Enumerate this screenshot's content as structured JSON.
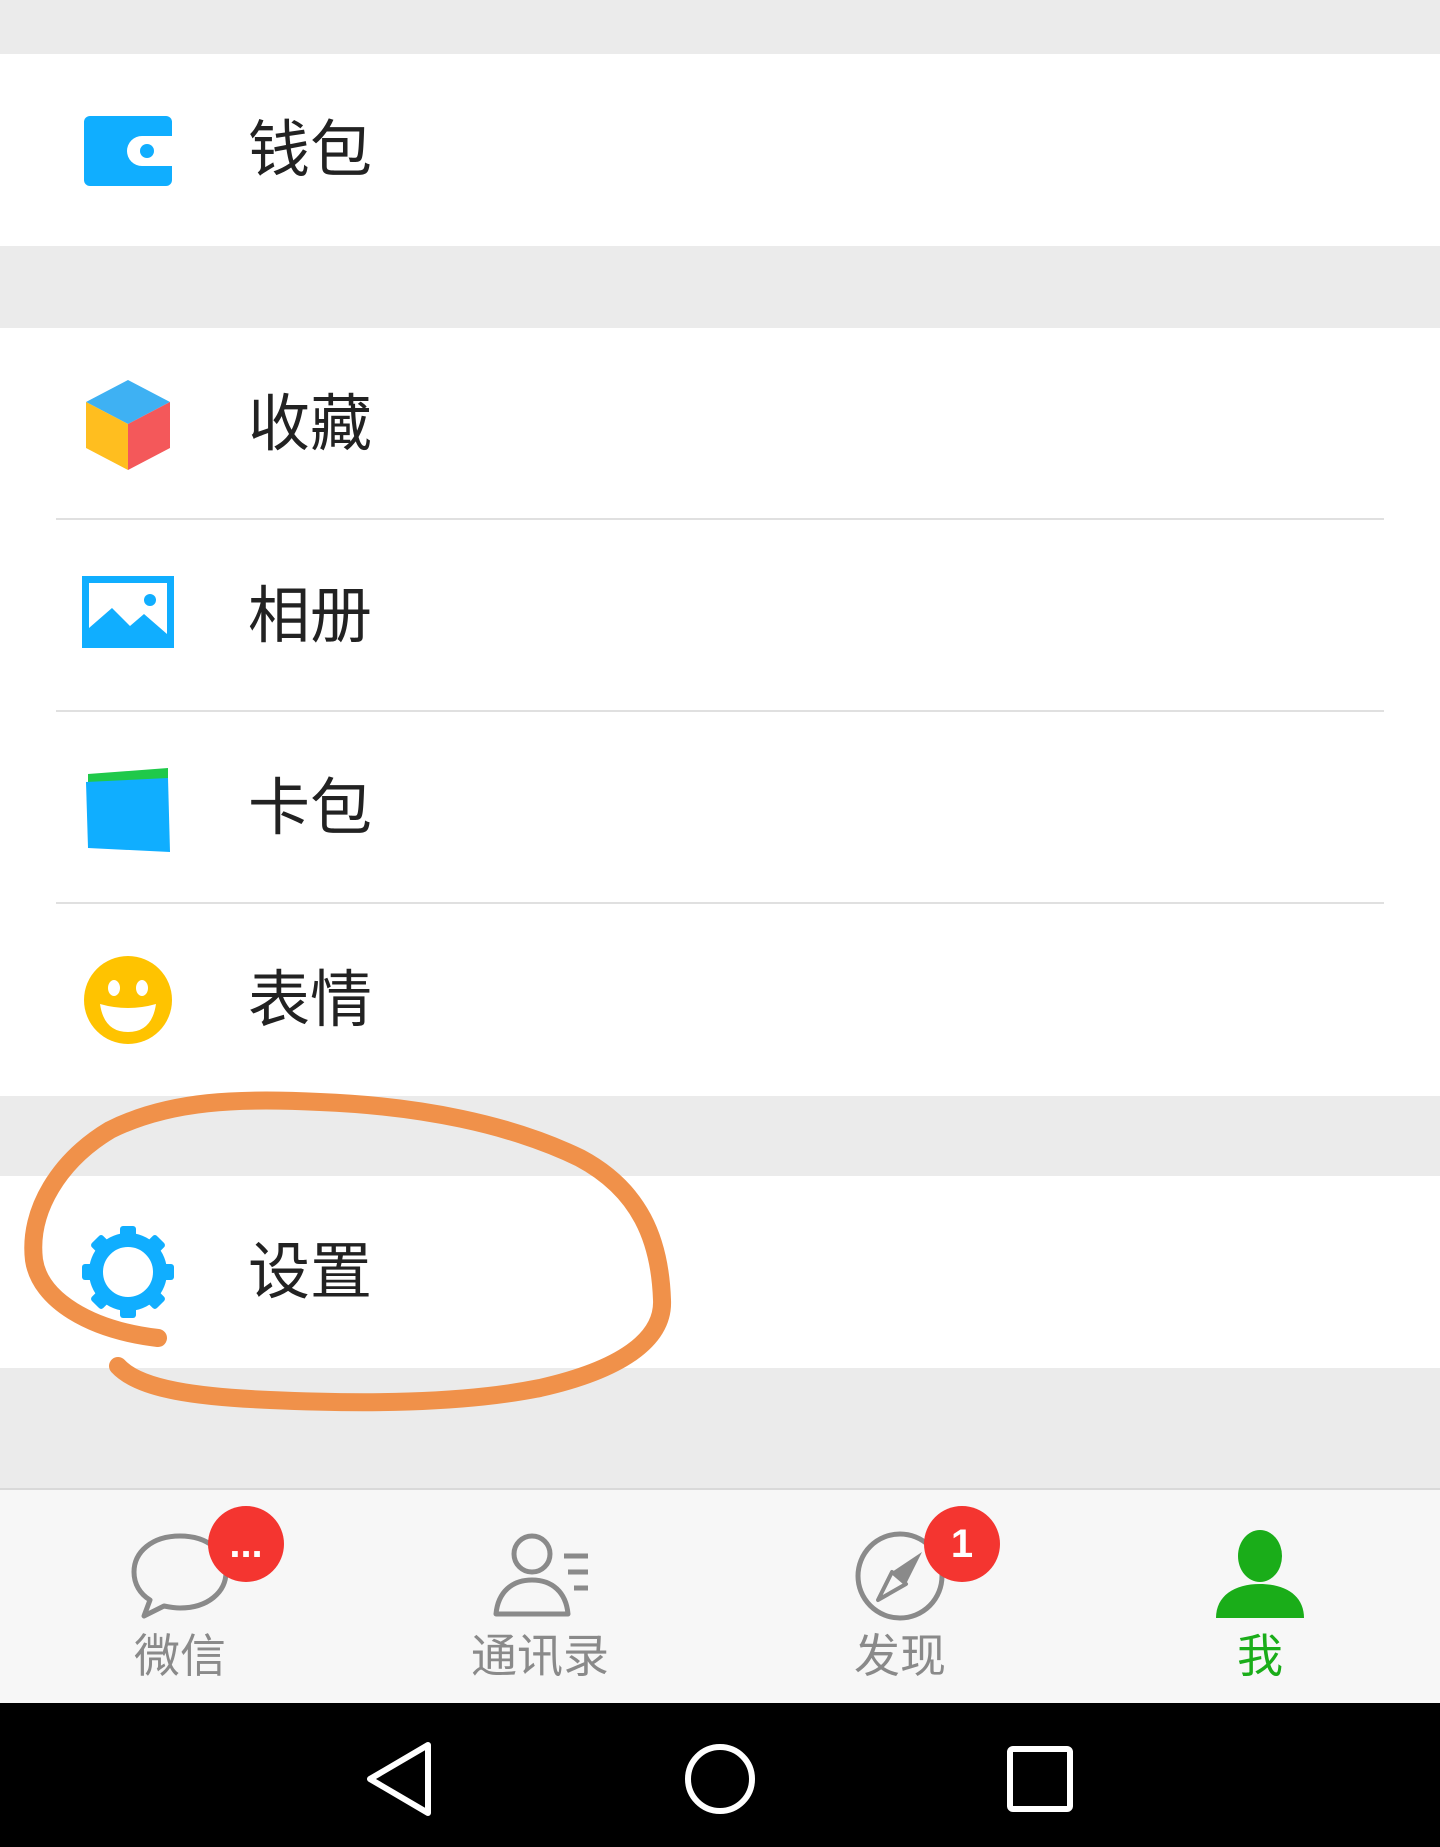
{
  "menu": {
    "wallet": {
      "label": "钱包",
      "icon": "wallet-icon"
    },
    "favorites": {
      "label": "收藏",
      "icon": "cube-icon"
    },
    "album": {
      "label": "相册",
      "icon": "image-icon"
    },
    "card_pack": {
      "label": "卡包",
      "icon": "card-icon"
    },
    "stickers": {
      "label": "表情",
      "icon": "smiley-icon"
    },
    "settings": {
      "label": "设置",
      "icon": "gear-icon"
    }
  },
  "annotation": {
    "shape": "freehand-circle",
    "target": "settings",
    "color": "#f0914a"
  },
  "tabbar": {
    "tabs": [
      {
        "label": "微信",
        "icon": "chat-bubble-icon",
        "badge": "...",
        "active": false
      },
      {
        "label": "通讯录",
        "icon": "contacts-icon",
        "badge": "",
        "active": false
      },
      {
        "label": "发现",
        "icon": "compass-icon",
        "badge": "1",
        "active": false
      },
      {
        "label": "我",
        "icon": "person-icon",
        "badge": "",
        "active": true
      }
    ]
  },
  "system_nav": [
    "back-icon",
    "home-icon",
    "recents-icon"
  ],
  "colors": {
    "accent_green": "#1aad19",
    "icon_blue": "#10aeff",
    "badge_red": "#f43530",
    "background": "#ebebeb"
  }
}
